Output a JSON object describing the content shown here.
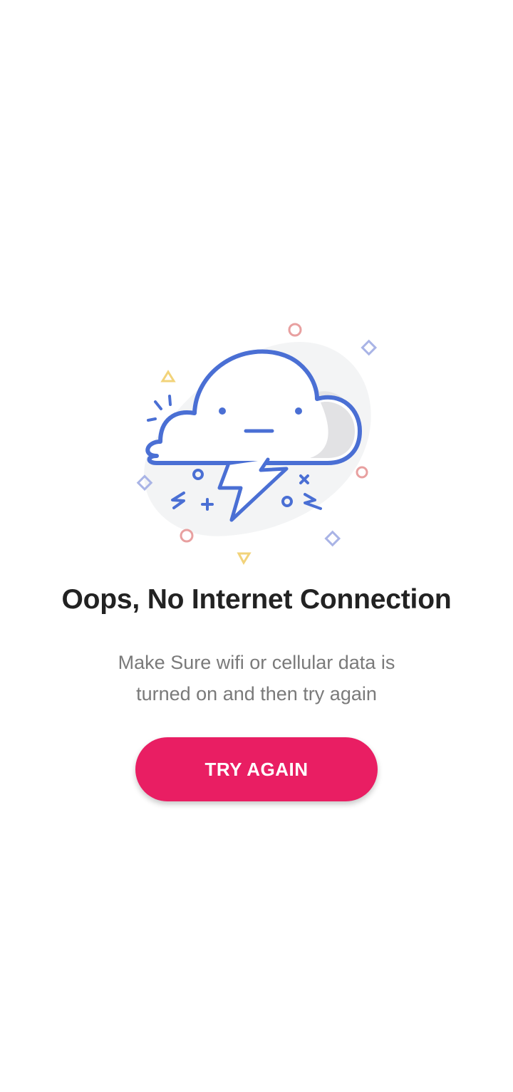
{
  "error": {
    "title": "Oops, No Internet Connection",
    "message_line1": "Make Sure wifi or cellular data is",
    "message_line2": "turned on and then try again",
    "retry_label": "TRY AGAIN"
  },
  "illustration": {
    "icon": "cloud-with-lightning-icon"
  },
  "colors": {
    "accent": "#e91e63",
    "cloud_stroke": "#4a6fd4",
    "title_text": "#222222",
    "body_text": "#7a7a7a",
    "confetti_red": "#e8a0a0",
    "confetti_yellow": "#f2d37a",
    "confetti_blue": "#a9b4e6"
  }
}
